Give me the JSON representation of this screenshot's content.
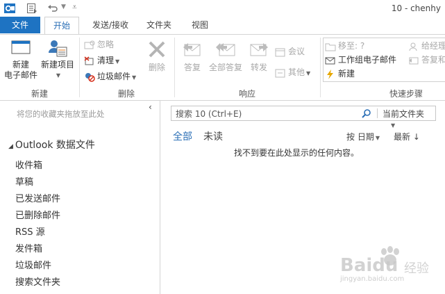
{
  "titlebar": {
    "title": "10 - chenhy",
    "icons": [
      "outlook-logo-icon",
      "send-receive-all-icon",
      "undo-icon",
      "customize-qat-icon"
    ]
  },
  "tabs": [
    {
      "label": "文件"
    },
    {
      "label": "开始"
    },
    {
      "label": "发送/接收"
    },
    {
      "label": "文件夹"
    },
    {
      "label": "视图"
    }
  ],
  "ribbon": {
    "groups": {
      "new": "新建",
      "delete": "删除",
      "respond": "响应",
      "quicksteps": "快速步骤"
    },
    "new_email": {
      "line1": "新建",
      "line2": "电子邮件"
    },
    "new_items": "新建项目",
    "ignore": "忽略",
    "cleanup": "清理",
    "junk": "垃圾邮件",
    "delete": "删除",
    "reply": "答复",
    "reply_all": "全部答复",
    "forward": "转发",
    "meeting": "会议",
    "more": "其他",
    "quicksteps": {
      "move_to": "移至: ?",
      "to_manager": "给经理",
      "team_email": "工作组电子邮件",
      "reply_delete": "答复和",
      "create_new": "新建"
    }
  },
  "left_pane": {
    "favorites_hint": "将您的收藏夹拖放至此处",
    "collapse_glyph": "‹",
    "account": "Outlook 数据文件",
    "account_glyph": "◢",
    "folders": [
      "收件箱",
      "草稿",
      "已发送邮件",
      "已删除邮件",
      "RSS 源",
      "发件箱",
      "垃圾邮件",
      "搜索文件夹"
    ]
  },
  "main": {
    "search_placeholder": "搜索 10 (Ctrl+E)",
    "search_scope": "当前文件夹",
    "filter_all": "全部",
    "filter_unread": "未读",
    "sort_by": "按 日期",
    "sort_order": "最新",
    "empty_message": "找不到要在此处显示的任何内容。"
  },
  "watermark": {
    "brand": "Baidu",
    "site": "jingyan.baidu.com",
    "cn": "经验"
  },
  "colors": {
    "accent": "#1e73c2",
    "tab_active_text": "#2b6fb6",
    "disabled": "#a8a8a8"
  }
}
